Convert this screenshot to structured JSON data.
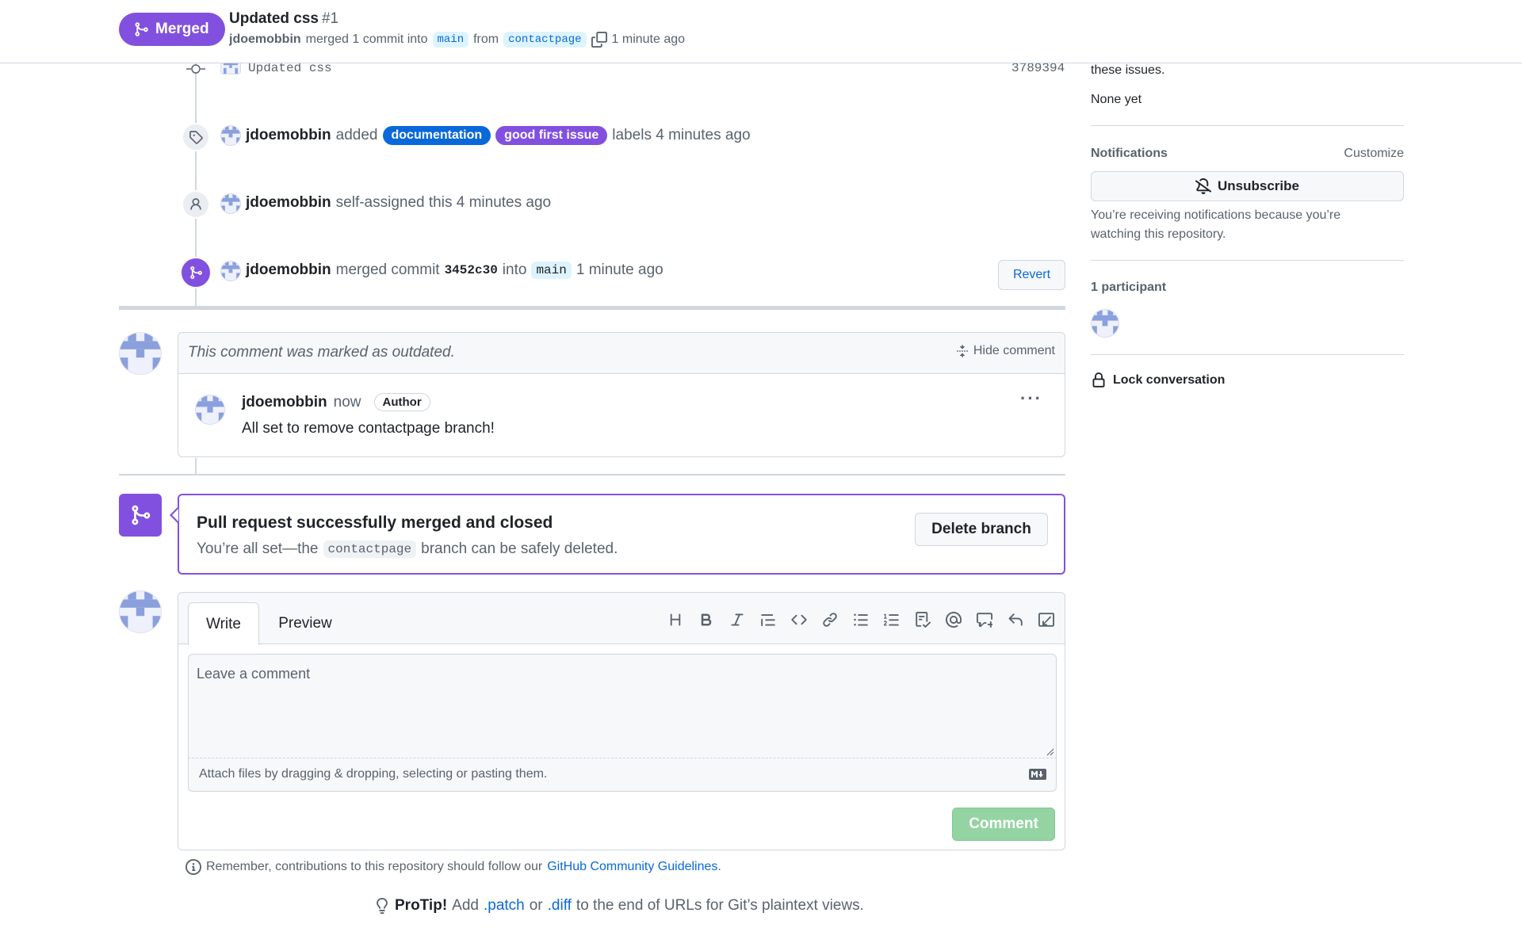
{
  "header": {
    "status_label": "Merged",
    "title": "Updated css",
    "number": "#1",
    "author": "jdoemobbin",
    "merged_text": "merged 1 commit into",
    "base_branch": "main",
    "from_text": "from",
    "head_branch": "contactpage",
    "time": "1 minute ago"
  },
  "timeline": {
    "commit": {
      "message": "Updated css",
      "sha": "3789394"
    },
    "labeled": {
      "user": "jdoemobbin",
      "action": "added",
      "labels": [
        {
          "name": "documentation",
          "color": "#0969da"
        },
        {
          "name": "good first issue",
          "color": "#8250df"
        }
      ],
      "suffix": "labels 4 minutes ago"
    },
    "assigned": {
      "user": "jdoemobbin",
      "text": "self-assigned this 4 minutes ago"
    },
    "merged": {
      "user": "jdoemobbin",
      "action": "merged commit",
      "sha": "3452c30",
      "into": "into",
      "branch": "main",
      "time": "1 minute ago",
      "revert_label": "Revert"
    }
  },
  "outdated_comment": {
    "notice": "This comment was marked as outdated.",
    "hide_label": "Hide comment",
    "user": "jdoemobbin",
    "time": "now",
    "badge": "Author",
    "body": "All set to remove contactpage branch!"
  },
  "merged_box": {
    "title": "Pull request successfully merged and closed",
    "prefix": "You’re all set—the",
    "branch": "contactpage",
    "suffix": "branch can be safely deleted.",
    "delete_label": "Delete branch"
  },
  "editor": {
    "tab_write": "Write",
    "tab_preview": "Preview",
    "placeholder": "Leave a comment",
    "attach_text": "Attach files by dragging & dropping, selecting or pasting them.",
    "submit_label": "Comment",
    "toolbar": [
      "heading-icon",
      "bold-icon",
      "italic-icon",
      "quote-icon",
      "code-icon",
      "link-icon",
      "bullet-list-icon",
      "numbered-list-icon",
      "task-list-icon",
      "mention-icon",
      "reference-icon",
      "undo-icon",
      "fullscreen-icon"
    ]
  },
  "footer": {
    "guidelines_prefix": "Remember, contributions to this repository should follow our",
    "guidelines_link": "GitHub Community Guidelines",
    "guidelines_suffix": ".",
    "protip_label": "ProTip!",
    "protip_add": "Add",
    "protip_patch": ".patch",
    "protip_or": "or",
    "protip_diff": ".diff",
    "protip_suffix": "to the end of URLs for Git’s plaintext views."
  },
  "sidebar": {
    "issues_tail": "these issues.",
    "none_yet": "None yet",
    "notifications_heading": "Notifications",
    "customize": "Customize",
    "unsubscribe": "Unsubscribe",
    "notify_reason": "You’re receiving notifications because you’re watching this repository.",
    "participants": "1 participant",
    "lock": "Lock conversation"
  },
  "colors": {
    "accent": "#8250df",
    "link": "#0969da",
    "comment_button": "#94d3a2"
  }
}
